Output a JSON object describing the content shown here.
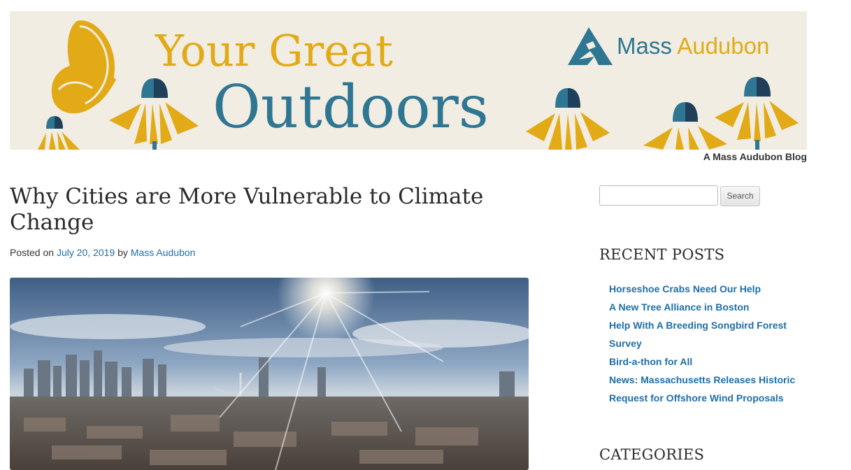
{
  "header": {
    "title_line1": "Your Great",
    "title_line2": "Outdoors",
    "brand_mass": "Mass",
    "brand_audubon": "Audubon",
    "tagline": "A Mass Audubon Blog",
    "colors": {
      "gold": "#e2aa16",
      "blue": "#2f7693",
      "cream": "#f1ede2"
    }
  },
  "post": {
    "title": "Why Cities are More Vulnerable to Climate Change",
    "meta_prefix": "Posted on ",
    "date": "July 20, 2019",
    "meta_by": " by ",
    "author": "Mass Audubon",
    "image_subject": "Boston skyline aerial photo with sun"
  },
  "sidebar": {
    "search_button": "Search",
    "search_value": "",
    "recent_posts_title": "RECENT POSTS",
    "recent_posts": [
      "Horseshoe Crabs Need Our Help",
      "A New Tree Alliance in Boston",
      "Help With A Breeding Songbird Forest Survey",
      "Bird-a-thon for All",
      "News: Massachusetts Releases Historic Request for Offshore Wind Proposals"
    ],
    "categories_title": "CATEGORIES"
  },
  "link_color": "#1e6fa8"
}
